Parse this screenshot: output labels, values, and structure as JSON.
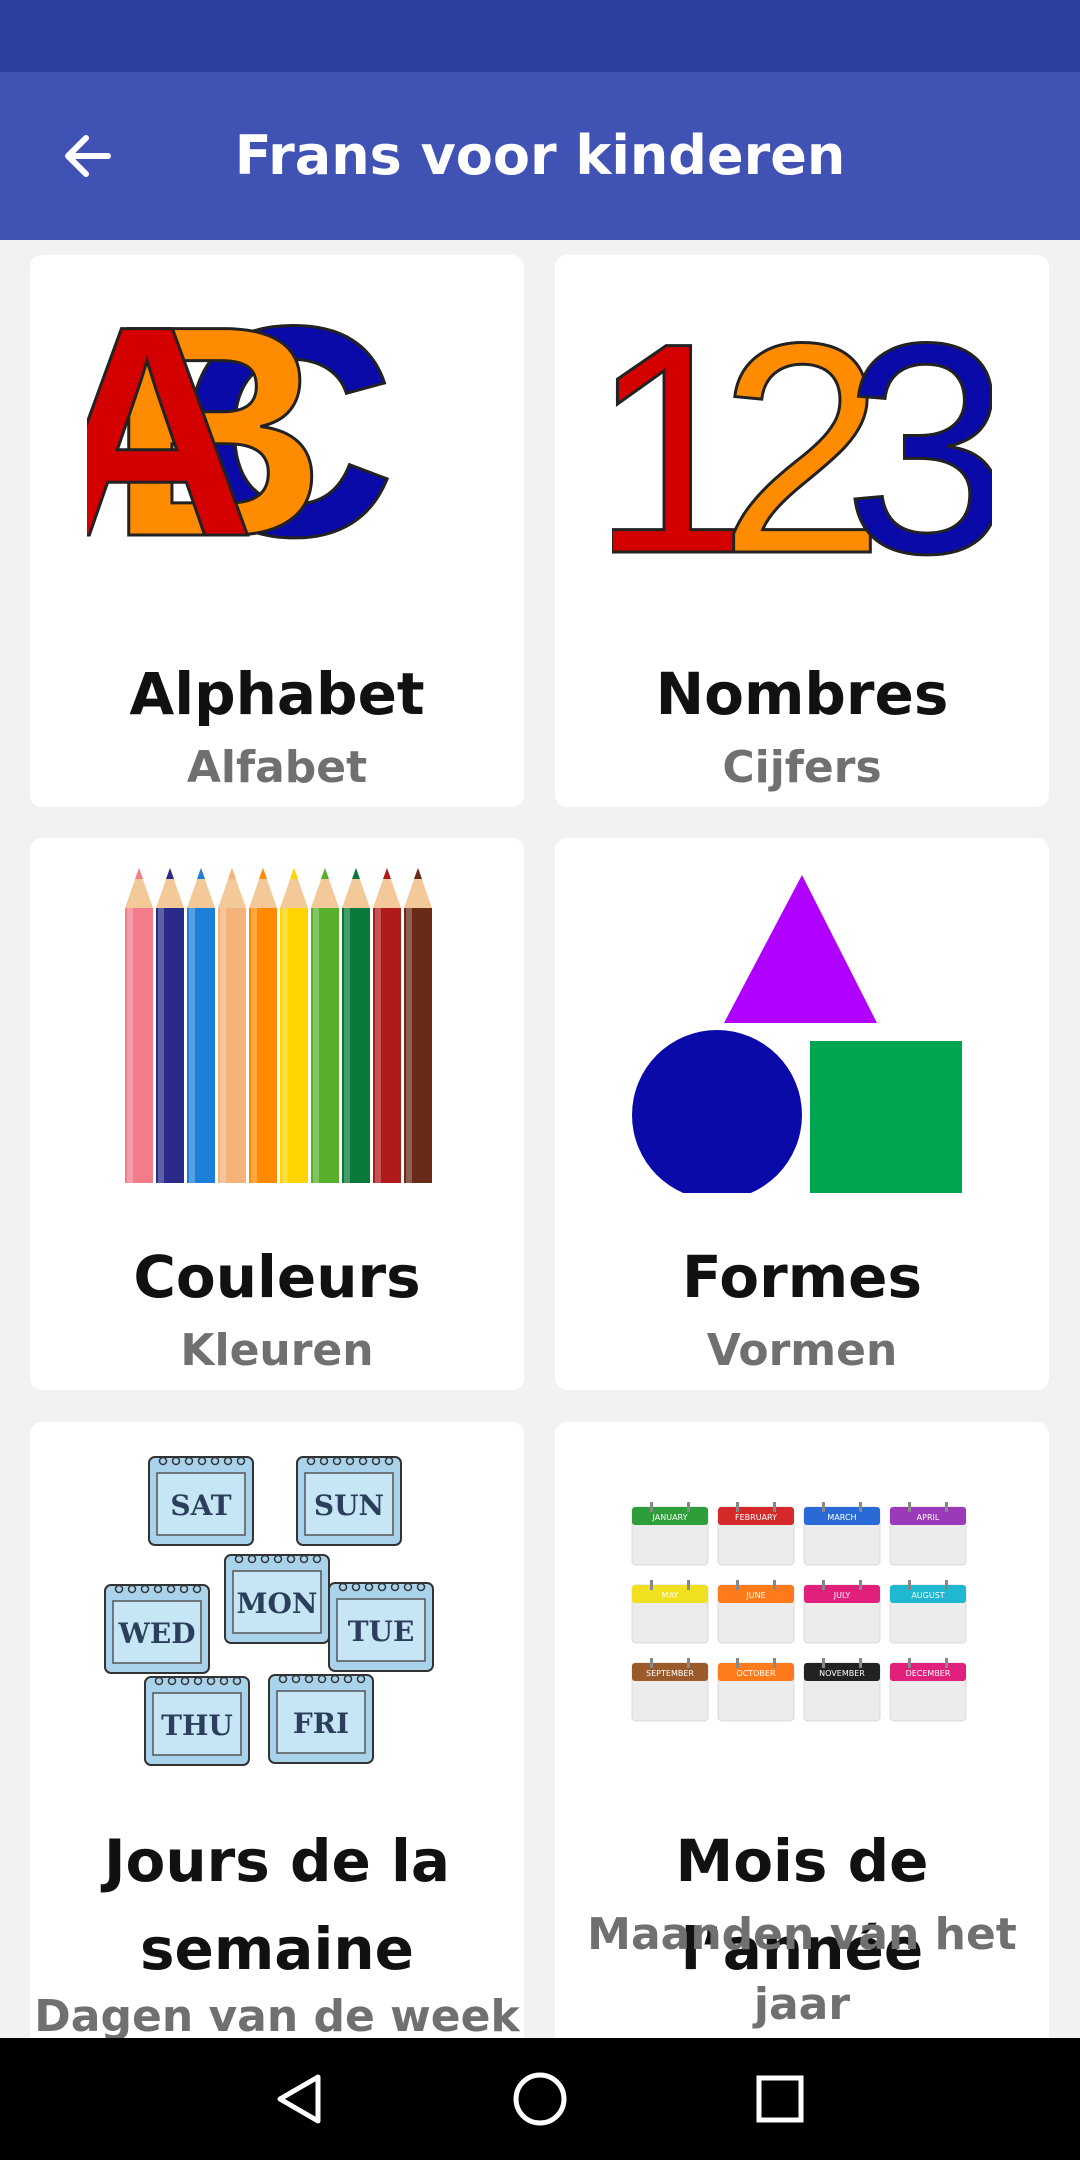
{
  "app_bar": {
    "title": "Frans voor kinderen",
    "back_icon": "arrow-left-icon"
  },
  "categories": [
    {
      "fr": "Alphabet",
      "nl": "Alfabet",
      "art": "abc-letters"
    },
    {
      "fr": "Nombres",
      "nl": "Cijfers",
      "art": "123-numbers"
    },
    {
      "fr": "Couleurs",
      "nl": "Kleuren",
      "art": "colored-pencils"
    },
    {
      "fr": "Formes",
      "nl": "Vormen",
      "art": "shapes"
    },
    {
      "fr": "Jours de la semaine",
      "nl": "Dagen van de week",
      "art": "day-calendars",
      "days": [
        "SAT",
        "SUN",
        "MON",
        "WED",
        "TUE",
        "THU",
        "FRI"
      ]
    },
    {
      "fr": "Mois de l’année",
      "nl": "Maanden van het jaar",
      "art": "month-calendars",
      "months": [
        "JANUARY",
        "FEBRUARY",
        "MARCH",
        "APRIL",
        "MAY",
        "JUNE",
        "JULY",
        "AUGUST",
        "SEPTEMBER",
        "OCTOBER",
        "NOVEMBER",
        "DECEMBER"
      ]
    }
  ],
  "colors": {
    "status_bar": "#2f3f9e",
    "app_bar": "#4152b5",
    "red": "#d40000",
    "orange": "#ff8c00",
    "blue": "#0a0aa8",
    "purple": "#b000ff",
    "green": "#00a550"
  },
  "nav": {
    "back_icon": "triangle-back-icon",
    "home_icon": "circle-home-icon",
    "recents_icon": "square-recents-icon"
  }
}
